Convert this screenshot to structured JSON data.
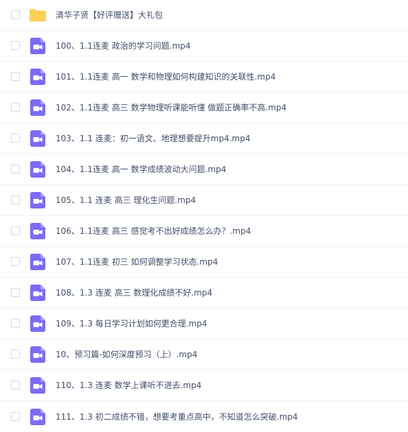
{
  "colors": {
    "folder": "#ffd157",
    "video": "#7b6cf6",
    "text": "#424e67"
  },
  "items": [
    {
      "type": "folder",
      "icon": "folder-icon",
      "name": "清华子贤【好评赠送】大礼包"
    },
    {
      "type": "video",
      "icon": "video-file-icon",
      "name": "100、1.1连麦 政治的学习问题.mp4"
    },
    {
      "type": "video",
      "icon": "video-file-icon",
      "name": "101、1.1连麦 高一 数学和物理如何构建知识的关联性.mp4"
    },
    {
      "type": "video",
      "icon": "video-file-icon",
      "name": "102、1.1连麦 高三 数学物理听课能听懂 做题正确率不高.mp4"
    },
    {
      "type": "video",
      "icon": "video-file-icon",
      "name": "103、1.1 连麦：初一语文、地理想要提升mp4.mp4"
    },
    {
      "type": "video",
      "icon": "video-file-icon",
      "name": "104、1.1连麦 高一 数学成绩波动大问题.mp4"
    },
    {
      "type": "video",
      "icon": "video-file-icon",
      "name": "105、1.1 连麦 高三 理化生问题.mp4"
    },
    {
      "type": "video",
      "icon": "video-file-icon",
      "name": "106、1.1连麦 高三 感觉考不出好成绩怎么办？.mp4"
    },
    {
      "type": "video",
      "icon": "video-file-icon",
      "name": "107、1.1连麦 初三 如何调整学习状态.mp4"
    },
    {
      "type": "video",
      "icon": "video-file-icon",
      "name": "108、1.3 连麦 高三 数理化成绩不好.mp4"
    },
    {
      "type": "video",
      "icon": "video-file-icon",
      "name": "109、1.3 每日学习计划如何更合理.mp4"
    },
    {
      "type": "video",
      "icon": "video-file-icon",
      "name": "10、预习篇-如何深度预习（上）.mp4"
    },
    {
      "type": "video",
      "icon": "video-file-icon",
      "name": "110、1.3 连麦 数学上课听不进去.mp4"
    },
    {
      "type": "video",
      "icon": "video-file-icon",
      "name": "111、1.3 初二成绩不错，想要考重点高中，不知道怎么突破.mp4"
    }
  ]
}
